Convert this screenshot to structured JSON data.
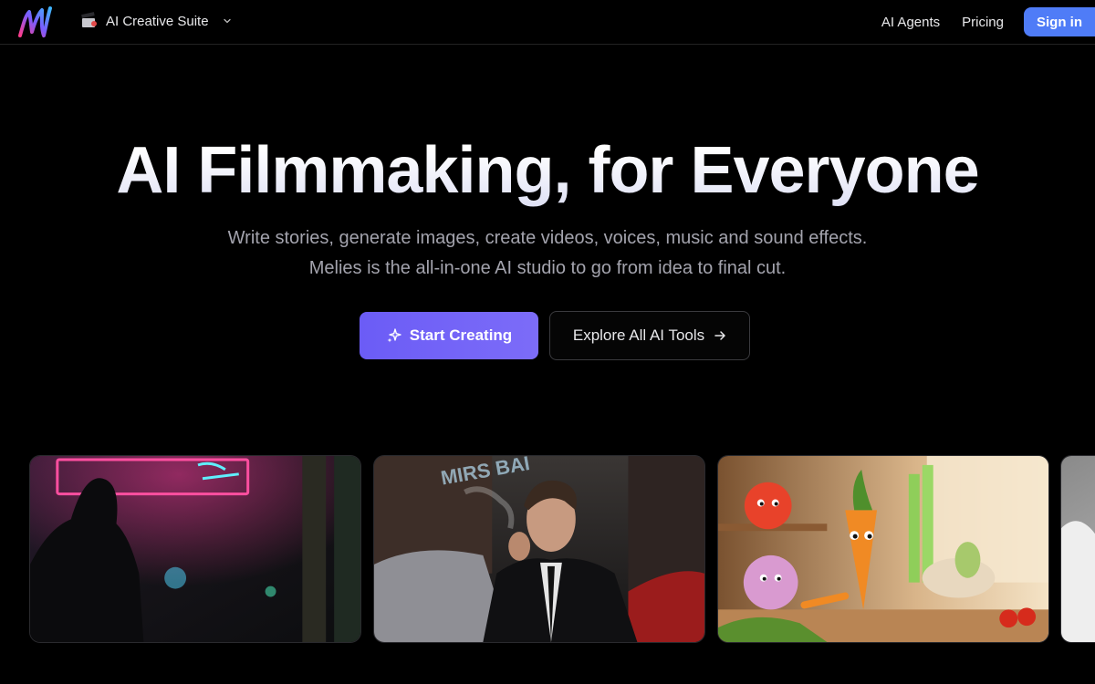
{
  "nav": {
    "logo_icon": "melies-logo-icon",
    "suite_icon": "clapperboard-icon",
    "suite_label": "AI Creative Suite",
    "links": [
      "AI Agents",
      "Pricing"
    ],
    "signin_label": "Sign in",
    "signin_color": "#4f7cf7"
  },
  "hero": {
    "title": "AI Filmmaking, for Everyone",
    "subtitle_line1": "Write stories, generate images, create videos, voices, music and sound effects.",
    "subtitle_line2": "Melies is the all-in-one AI studio to go from idea to final cut.",
    "primary_button": {
      "label": "Start Creating",
      "icon": "sparkles-icon",
      "color": "#6b5cf6"
    },
    "secondary_button": {
      "label": "Explore All AI Tools",
      "icon": "arrow-right-icon"
    }
  },
  "gallery": {
    "items": [
      "neon-street-silhouette",
      "man-smoking-in-convertible",
      "cartoon-vegetables-kitchen",
      "grayscale-partial-card"
    ]
  }
}
